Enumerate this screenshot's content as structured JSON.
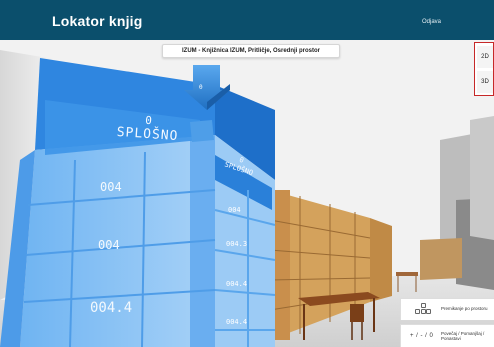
{
  "app": {
    "title": "Lokator knjig",
    "logout_label": "Odjava"
  },
  "location": {
    "label": "IZUM - Knjižnica IZUM, Pritličje, Osrednji prostor"
  },
  "view_toggle": {
    "btn_2d": "2D",
    "btn_3d": "3D",
    "active": "3D"
  },
  "shelves": {
    "main_header_code": "0",
    "main_header_name": "SPLOŠNO",
    "sub_header_code": "0",
    "sub_header_name": "SPLOŠNO",
    "left_labels": [
      "004",
      "004",
      "004.4"
    ],
    "right_labels": [
      "004",
      "004.3",
      "004.4",
      "004.4"
    ],
    "small_box_label": "0"
  },
  "hints": {
    "move_keys_label": "Premikanje po prostoru",
    "zoom_symbol": "+ / - / 0",
    "zoom_label": "Povečaj / Pomanjšaj / Ponastavi"
  },
  "colors": {
    "header_bar": "#0b4f6c",
    "highlight_shelf": "#3a8fe6",
    "wood_shelf": "#d4a25c",
    "toggle_border": "#c62828"
  }
}
